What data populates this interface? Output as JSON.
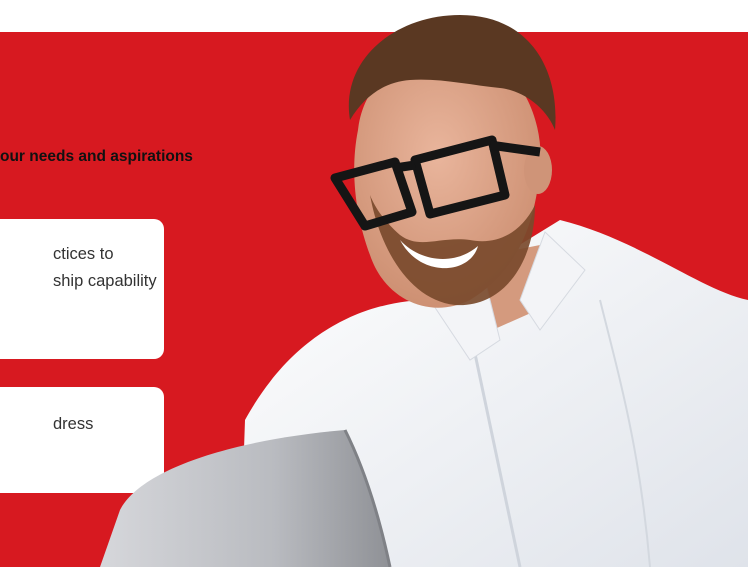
{
  "hero": {
    "heading": "our needs and aspirations",
    "cards": [
      {
        "lines": [
          "ctices to",
          "ship capability"
        ]
      },
      {
        "lines": [
          "dress"
        ]
      }
    ]
  },
  "colors": {
    "brand_red": "#d71920",
    "card_bg": "#ffffff",
    "text_dark": "#111111"
  },
  "photo": {
    "subject": "smiling-man-with-glasses-at-laptop"
  }
}
